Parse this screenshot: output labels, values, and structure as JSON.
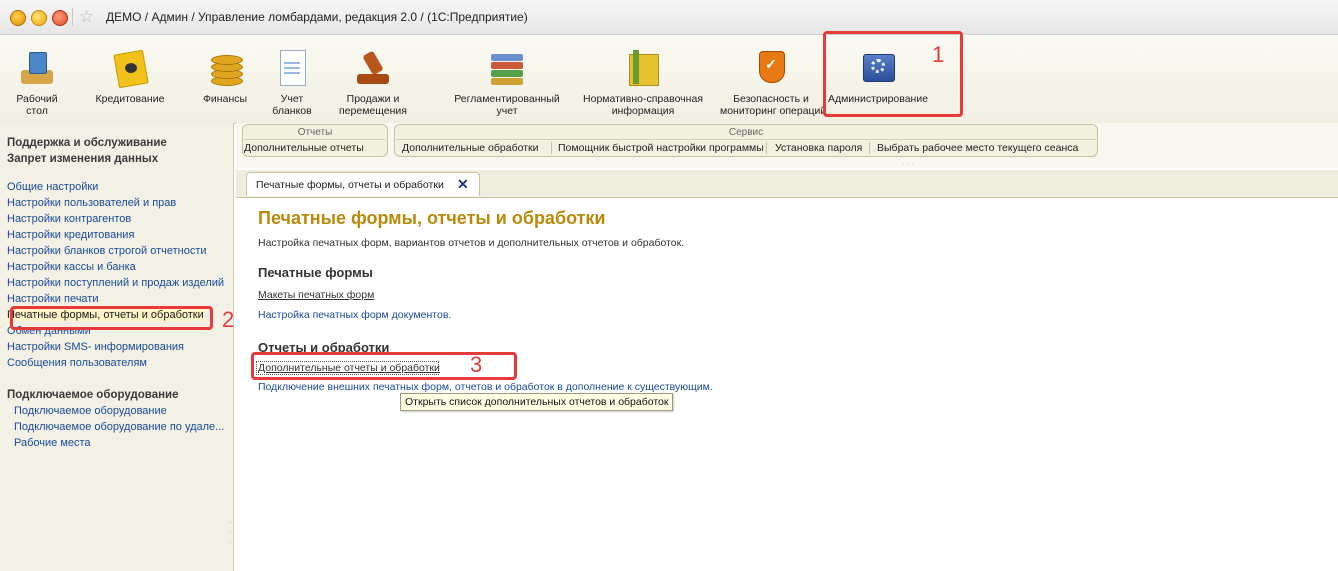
{
  "window": {
    "title": "ДЕМО / Админ / Управление ломбардами, редакция 2.0 /  (1С:Предприятие)"
  },
  "toolbar": {
    "items": [
      {
        "label1": "Рабочий",
        "label2": "стол"
      },
      {
        "label1": "Кредитование",
        "label2": ""
      },
      {
        "label1": "Финансы",
        "label2": ""
      },
      {
        "label1": "Учет",
        "label2": "бланков"
      },
      {
        "label1": "Продажи и",
        "label2": "перемещения"
      },
      {
        "label1": "Регламентированный",
        "label2": "учет"
      },
      {
        "label1": "Нормативно-справочная",
        "label2": "информация"
      },
      {
        "label1": "Безопасность и",
        "label2": "мониторинг операций"
      },
      {
        "label1": "Администрирование",
        "label2": ""
      }
    ]
  },
  "callouts": {
    "one": "1",
    "two": "2",
    "three": "3"
  },
  "sidebar": {
    "head1": "Поддержка и обслуживание",
    "head2": "Запрет изменения данных",
    "items": [
      "Общие настройки",
      "Настройки пользователей и прав",
      "Настройки контрагентов",
      "Настройки кредитования",
      "Настройки бланков строгой отчетности",
      "Настройки кассы и банка",
      "Настройки поступлений и продаж изделий",
      "Настройки печати",
      "Печатные формы, отчеты и обработки",
      "Обмен данными",
      "Настройки SMS- информирования",
      "Сообщения пользователям"
    ],
    "head3": "Подключаемое оборудование",
    "subitems": [
      "Подключаемое оборудование",
      "Подключаемое оборудование по удале...",
      "Рабочие места"
    ]
  },
  "panels": {
    "group1": {
      "title": "Отчеты",
      "links": [
        "Дополнительные отчеты"
      ]
    },
    "group2": {
      "title": "Сервис",
      "links": [
        "Дополнительные обработки",
        "Помощник быстрой настройки программы",
        "Установка пароля",
        "Выбрать рабочее место текущего сеанса"
      ]
    }
  },
  "tab": {
    "label": "Печатные формы, отчеты и обработки",
    "close": "✕"
  },
  "main": {
    "title": "Печатные формы, отчеты и обработки",
    "description": "Настройка печатных форм, вариантов отчетов и дополнительных отчетов и обработок.",
    "section1": {
      "heading": "Печатные формы",
      "link": "Макеты печатных форм",
      "note": "Настройка печатных форм документов."
    },
    "section2": {
      "heading": "Отчеты и обработки",
      "link": "Дополнительные отчеты и обработки",
      "note": "Подключение внешних печатных форм, отчетов и обработок в дополнение к существующим."
    },
    "tooltip": "Открыть список дополнительных отчетов и обработок"
  },
  "colors": {
    "accent": "#e53b3b",
    "title": "#b98a0c",
    "link": "#1a4a9c"
  }
}
